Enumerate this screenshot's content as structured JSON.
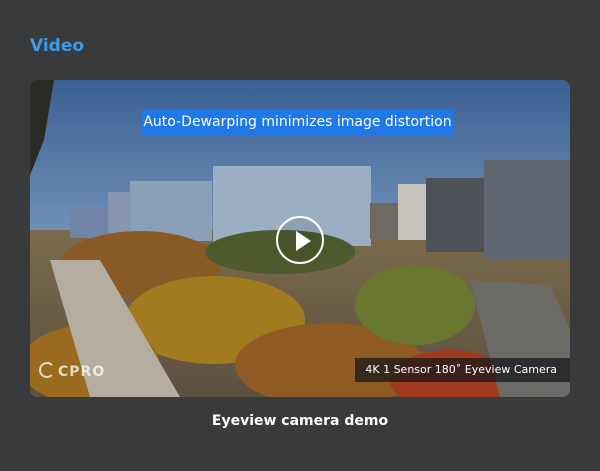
{
  "section": {
    "title": "Video"
  },
  "video": {
    "overlay_caption": "Auto-Dewarping minimizes image distortion",
    "watermark": "CPRO",
    "spec_caption": "4K 1 Sensor 180˚ Eyeview Camera",
    "title": "Eyeview camera demo",
    "play_icon": "play-icon"
  },
  "colors": {
    "page_background": "#393a3c",
    "accent": "#3d9be8",
    "caption_background": "#1f78e8"
  }
}
